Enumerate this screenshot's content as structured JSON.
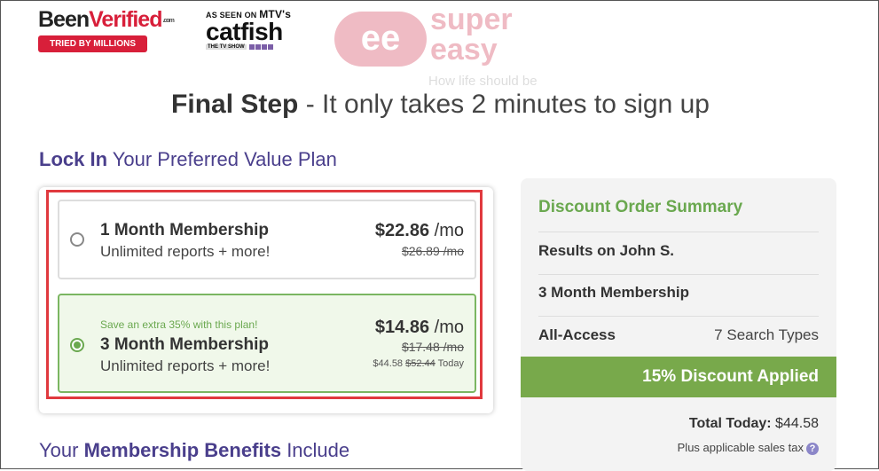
{
  "header": {
    "logo_left": "Been",
    "logo_right": "Verified",
    "logo_com": ".com",
    "badge": "TRIED BY MILLIONS",
    "seen_on": "AS SEEN ON",
    "network": "MTV's",
    "show": "catfish",
    "show_sub": "THE TV SHOW",
    "watermark_symbol": "ee",
    "watermark_line1": "super",
    "watermark_line2": "easy",
    "watermark_tagline": "How life should be"
  },
  "title": {
    "bold": "Final Step",
    "rest": " - It only takes 2 minutes to sign up"
  },
  "lock_heading": {
    "bold": "Lock In",
    "rest": " Your Preferred Value Plan"
  },
  "plans": [
    {
      "name": "1 Month Membership",
      "desc": "Unlimited reports + more!",
      "price": "$22.86",
      "per": " /mo",
      "old_price": "$26.89 /mo",
      "selected": false
    },
    {
      "save_note": "Save an extra 35% with this plan!",
      "name": "3 Month Membership",
      "desc": "Unlimited reports + more!",
      "price": "$14.86",
      "per": " /mo",
      "old_price": "$17.48 /mo",
      "today_price": "$44.58",
      "today_old": "$52.44",
      "today_label": "Today",
      "selected": true
    }
  ],
  "summary": {
    "heading": "Discount Order Summary",
    "results": "Results on John S.",
    "membership": "3 Month Membership",
    "access_label": "All-Access",
    "access_value": "7 Search Types",
    "discount": "15% Discount Applied",
    "total_label": "Total Today:",
    "total_value": " $44.58",
    "tax_note": "Plus applicable sales tax",
    "help_icon": "?"
  },
  "benefits_heading": {
    "pre": "Your ",
    "bold": "Membership Benefits",
    "post": " Include"
  },
  "colors": {
    "accent_green": "#6aa84f",
    "brand_purple": "#4a3f8c",
    "brand_red": "#d81f3a",
    "highlight_red": "#e0393e"
  }
}
